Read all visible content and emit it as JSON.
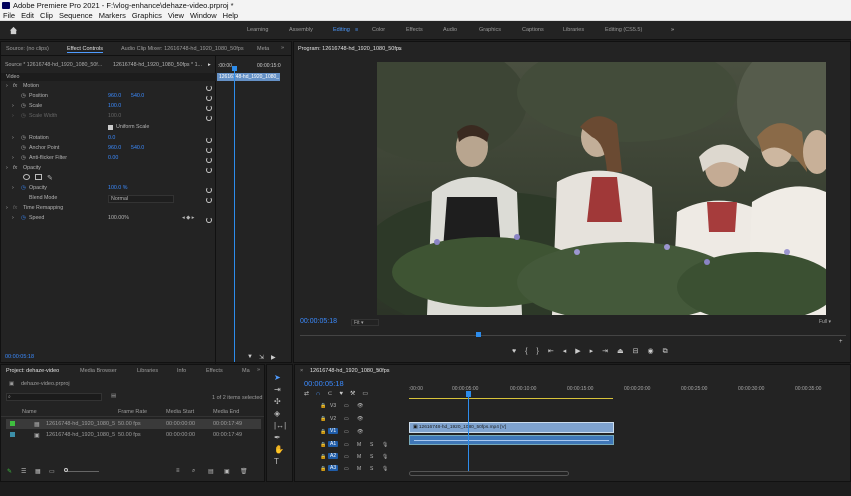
{
  "window": {
    "title": "Adobe Premiere Pro 2021 - F:\\vlog-enhance\\dehaze-video.prproj *"
  },
  "menu": [
    "File",
    "Edit",
    "Clip",
    "Sequence",
    "Markers",
    "Graphics",
    "View",
    "Window",
    "Help"
  ],
  "workspaces": [
    "Learning",
    "Assembly",
    "Editing",
    "Color",
    "Effects",
    "Audio",
    "Graphics",
    "Captions",
    "Libraries",
    "Editing (CS5.5)"
  ],
  "active_workspace": "Editing",
  "source_panel": {
    "tabs": [
      "Source: (no clips)",
      "Effect Controls",
      "Audio Clip Mixer: 12616748-hd_1920_1080_50fps",
      "Meta"
    ],
    "source_label": "Source * 12616748-hd_1920_1080_50f...",
    "seq_label": "12616748-hd_1920_1080_50fps * 1...",
    "time_start": ":00:00",
    "time_end": "00:00:15:0",
    "clip_label": "12616748-hd_1920_1080_",
    "section": "Video",
    "motion": "Motion",
    "position_label": "Position",
    "position_x": "960.0",
    "position_y": "540.0",
    "scale_label": "Scale",
    "scale_val": "100.0",
    "scale_width_label": "Scale Width",
    "scale_width_val": "100.0",
    "uniform_label": "Uniform Scale",
    "rotation_label": "Rotation",
    "rotation_val": "0.0",
    "anchor_label": "Anchor Point",
    "anchor_x": "960.0",
    "anchor_y": "540.0",
    "antiflicker_label": "Anti-flicker Filter",
    "antiflicker_val": "0.00",
    "opacity_section": "Opacity",
    "opacity_label": "Opacity",
    "opacity_val": "100.0 %",
    "blend_label": "Blend Mode",
    "blend_val": "Normal",
    "remap_section": "Time Remapping",
    "speed_label": "Speed",
    "speed_val": "100.00%",
    "timecode": "00:00:05:18"
  },
  "program": {
    "tab": "Program: 12616748-hd_1920_1080_50fps",
    "timecode": "00:00:05:18",
    "fit": "Fit",
    "full": "Full"
  },
  "project": {
    "tabs": [
      "Project: dehaze-video",
      "Media Browser",
      "Libraries",
      "Info",
      "Effects",
      "Ma"
    ],
    "file": "dehaze-video.prproj",
    "selection": "1 of 2 items selected",
    "columns": [
      "Name",
      "Frame Rate",
      "Media Start",
      "Media End"
    ],
    "rows": [
      {
        "name": "12616748-hd_1920_1080_5",
        "rate": "50.00 fps",
        "start": "00:00:00:00",
        "end": "00:00:17:49"
      },
      {
        "name": "12616748-hd_1920_1080_5",
        "rate": "50.00 fps",
        "start": "00:00:00:00",
        "end": "00:00:17:49"
      }
    ]
  },
  "timeline": {
    "tab": "12616748-hd_1920_1080_50fps",
    "timecode": "00:00:05:18",
    "ruler": [
      ":00:00",
      "00:00:05:00",
      "00:00:10:00",
      "00:00:15:00",
      "00:00:20:00",
      "00:00:25:00",
      "00:00:30:00",
      "00:00:35:00"
    ],
    "tracks": [
      "V3",
      "V2",
      "V1",
      "A1",
      "A2",
      "A3"
    ],
    "clip_label": "12616748-hd_1920_1080_50fps.mp4 [V]"
  },
  "colors": {
    "accent": "#2d8ceb",
    "panel": "#232323",
    "label_green": "#3fbf3f"
  }
}
